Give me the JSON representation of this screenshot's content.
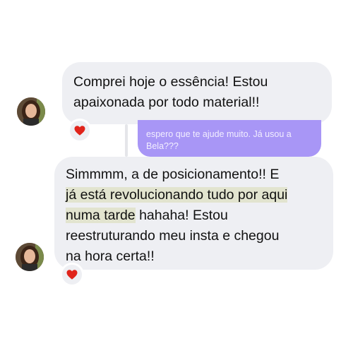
{
  "messages": [
    {
      "lines": [
        "Comprei hoje o essência! Estou",
        "apaixonada por todo material!!"
      ],
      "reaction": "heart-emoji"
    },
    {
      "quoted_reply": [
        "espero que te ajude muito. Já usou a",
        "Bela???"
      ]
    },
    {
      "line1": "Simmmm, a de posicionamento!! E",
      "line2_highlight": "já está revolucionando tudo por aqui",
      "line3_highlight": "numa tarde",
      "line3_rest": " hahaha! Estou",
      "line4": "reestruturando meu insta e chegou",
      "line5": "na hora certa!!",
      "reaction": "heart-emoji"
    }
  ],
  "colors": {
    "bubble": "#eeeff3",
    "quoted_bubble": "#a896f6",
    "highlight": "#e2e4cf",
    "reaction_heart": "#e0241b"
  }
}
